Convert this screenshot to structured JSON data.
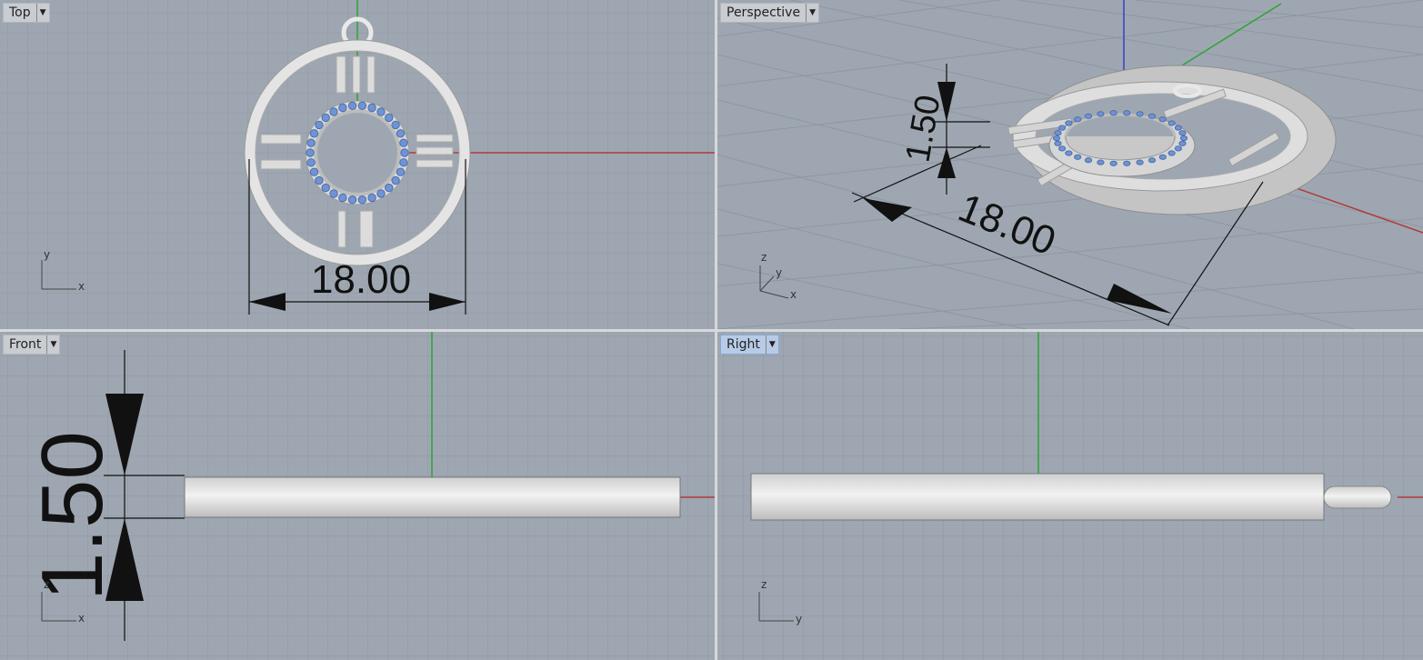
{
  "viewports": {
    "top": {
      "label": "Top",
      "axes": {
        "a": "y",
        "b": "x"
      },
      "dimension": "18.00"
    },
    "perspective": {
      "label": "Perspective",
      "axes": {
        "a": "z",
        "b": "y",
        "c": "x"
      },
      "dimension_width": "18.00",
      "dimension_height": "1.50"
    },
    "front": {
      "label": "Front",
      "axes": {
        "a": "z",
        "b": "x"
      },
      "dimension": "1.50"
    },
    "right": {
      "label": "Right",
      "axes": {
        "a": "z",
        "b": "y"
      }
    }
  },
  "colors": {
    "viewport_bg": "#9ea7b1",
    "grid": "#8e97a2",
    "grid_major": "#7f8894",
    "x_axis": "#b03a3a",
    "y_axis": "#2ea236",
    "z_axis": "#3a3ad0",
    "active_tab": "#b7cbe6",
    "gem": "#6f93d6"
  },
  "icons": [
    "dropdown-arrow-icon"
  ]
}
